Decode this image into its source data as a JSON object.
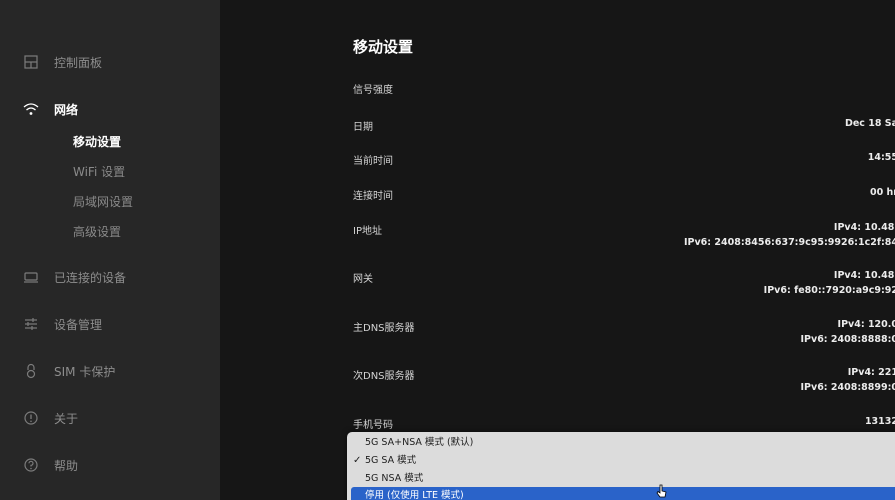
{
  "sidebar": {
    "items": [
      {
        "label": "控制面板",
        "icon": "dashboard-icon"
      },
      {
        "label": "网络",
        "icon": "wifi-icon"
      },
      {
        "label": "已连接的设备",
        "icon": "devices-icon"
      },
      {
        "label": "设备管理",
        "icon": "sliders-icon"
      },
      {
        "label": "SIM 卡保护",
        "icon": "lock-icon"
      },
      {
        "label": "关于",
        "icon": "info-icon"
      },
      {
        "label": "帮助",
        "icon": "help-icon"
      }
    ],
    "network_sub": [
      "移动设置",
      "WiFi 设置",
      "局域网设置",
      "高级设置"
    ]
  },
  "main": {
    "title": "移动设置",
    "rows": [
      {
        "label": "信号强度",
        "value1": "",
        "value2": ""
      },
      {
        "label": "日期",
        "value1": "Dec 18 Sa",
        "value2": ""
      },
      {
        "label": "当前时间",
        "value1": "14:55",
        "value2": ""
      },
      {
        "label": "连接时间",
        "value1": "00 hr",
        "value2": ""
      },
      {
        "label": "IP地址",
        "value1": "IPv4: 10.48.",
        "value2": "IPv6: 2408:8456:637:9c95:9926:1c2f:84"
      },
      {
        "label": "网关",
        "value1": "IPv4: 10.48.",
        "value2": "IPv6: fe80::7920:a9c9:92"
      },
      {
        "label": "主DNS服务器",
        "value1": "IPv4: 120.0",
        "value2": "IPv6: 2408:8888:0"
      },
      {
        "label": "次DNS服务器",
        "value1": "IPv4: 221",
        "value2": "IPv6: 2408:8899:0"
      },
      {
        "label": "手机号码",
        "value1": "13132",
        "value2": ""
      }
    ]
  },
  "dropdown": {
    "options": [
      {
        "label": "5G SA+NSA 模式 (默认)",
        "checked": false,
        "highlighted": false
      },
      {
        "label": "5G SA 模式",
        "checked": true,
        "highlighted": false
      },
      {
        "label": "5G NSA 模式",
        "checked": false,
        "highlighted": false
      },
      {
        "label": "停用 (仅使用 LTE 模式)",
        "checked": false,
        "highlighted": true
      }
    ],
    "check_glyph": "✓"
  },
  "colors": {
    "sidebar_bg": "#272727",
    "main_bg": "#161616",
    "highlight": "#2a63c9",
    "dropdown_bg": "#dcdcdc"
  }
}
